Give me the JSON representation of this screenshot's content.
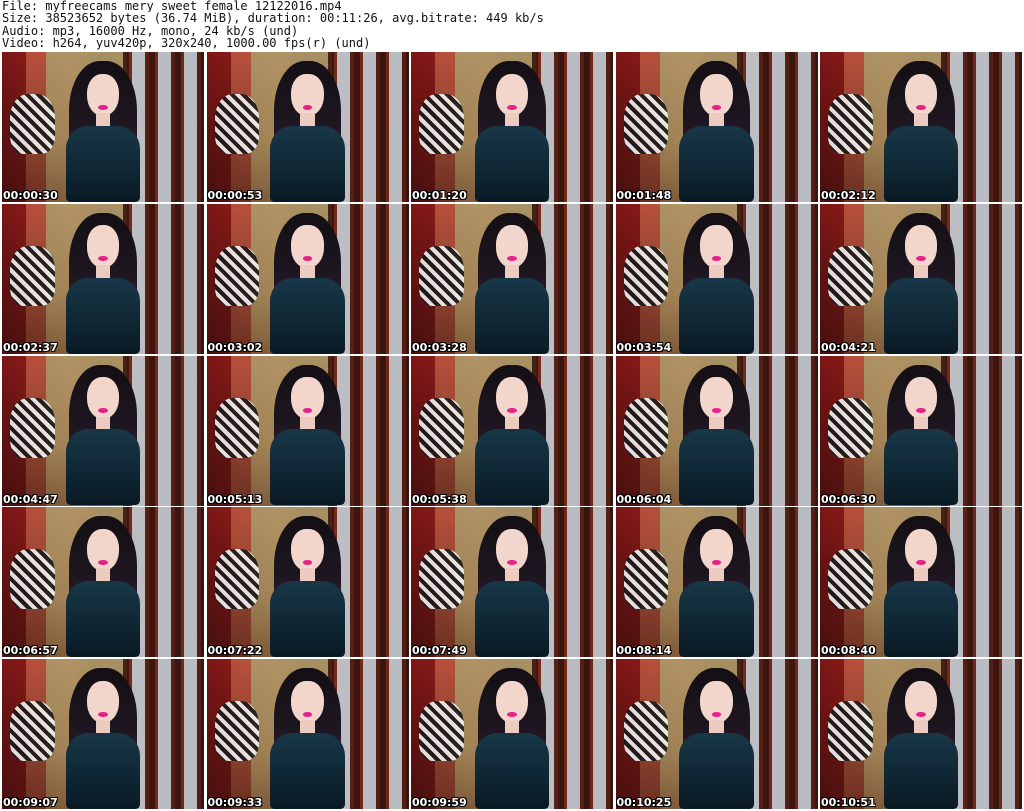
{
  "header": {
    "file_line": "File: myfreecams_mery_sweet_female_12122016.mp4",
    "size_line": "Size: 38523652 bytes (36.74 MiB), duration: 00:11:26, avg.bitrate: 449 kb/s",
    "audio_line": "Audio: mp3, 16000 Hz, mono, 24 kb/s (und)",
    "video_line": "Video: h264, yuv420p, 320x240, 1000.00 fps(r) (und)"
  },
  "thumbnails": [
    {
      "time": "00:00:30"
    },
    {
      "time": "00:00:53"
    },
    {
      "time": "00:01:20"
    },
    {
      "time": "00:01:48"
    },
    {
      "time": "00:02:12"
    },
    {
      "time": "00:02:37"
    },
    {
      "time": "00:03:02"
    },
    {
      "time": "00:03:28"
    },
    {
      "time": "00:03:54"
    },
    {
      "time": "00:04:21"
    },
    {
      "time": "00:04:47"
    },
    {
      "time": "00:05:13"
    },
    {
      "time": "00:05:38"
    },
    {
      "time": "00:06:04"
    },
    {
      "time": "00:06:30"
    },
    {
      "time": "00:06:57"
    },
    {
      "time": "00:07:22"
    },
    {
      "time": "00:07:49"
    },
    {
      "time": "00:08:14"
    },
    {
      "time": "00:08:40"
    },
    {
      "time": "00:09:07"
    },
    {
      "time": "00:09:33"
    },
    {
      "time": "00:09:59"
    },
    {
      "time": "00:10:25"
    },
    {
      "time": "00:10:51"
    }
  ]
}
